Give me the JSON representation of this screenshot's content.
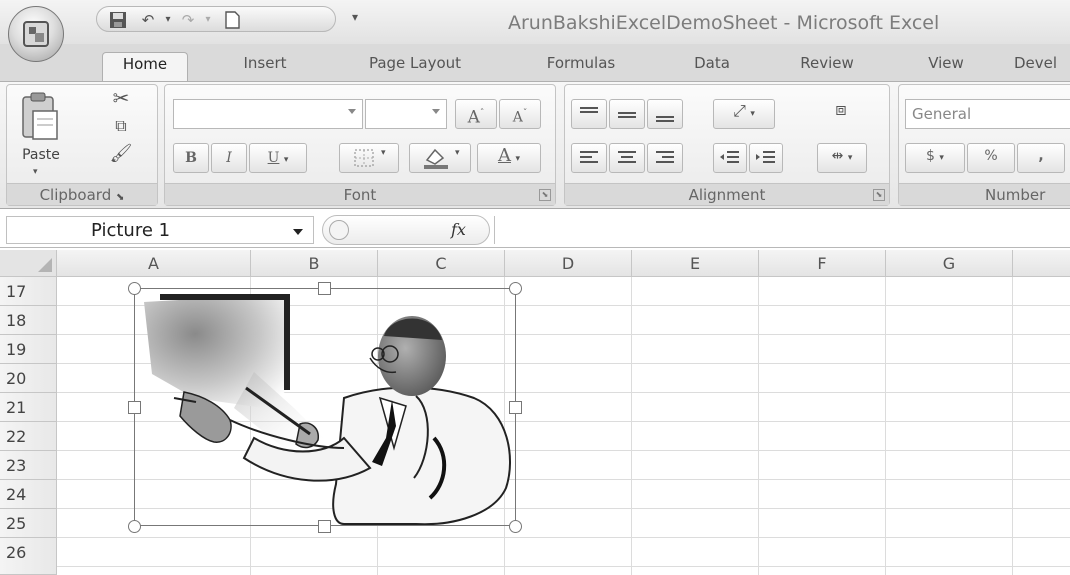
{
  "window": {
    "title": "ArunBakshiExcelDemoSheet - Microsoft Excel"
  },
  "tabs": [
    "Home",
    "Insert",
    "Page Layout",
    "Formulas",
    "Data",
    "Review",
    "View",
    "Devel"
  ],
  "active_tab": "Home",
  "ribbon": {
    "clipboard": {
      "label": "Clipboard",
      "paste_label": "Paste"
    },
    "font": {
      "label": "Font",
      "font_name": "",
      "font_size": "",
      "bold": "B",
      "italic": "I",
      "underline": "U"
    },
    "alignment": {
      "label": "Alignment"
    },
    "number": {
      "label": "Number",
      "format": "General",
      "currency": "$",
      "percent": "%",
      "comma": ","
    }
  },
  "formula_bar": {
    "name_box": "Picture 1",
    "fx_label": "fx",
    "formula": ""
  },
  "grid": {
    "columns": [
      "A",
      "B",
      "C",
      "D",
      "E",
      "F",
      "G"
    ],
    "rows": [
      "17",
      "18",
      "19",
      "20",
      "21",
      "22",
      "23",
      "24",
      "25",
      "26"
    ]
  },
  "picture": {
    "name": "Picture 1"
  },
  "colors": {
    "chrome": "#e2e2e2",
    "grid_line": "#dcdcdc",
    "header": "#e4e4e4"
  }
}
